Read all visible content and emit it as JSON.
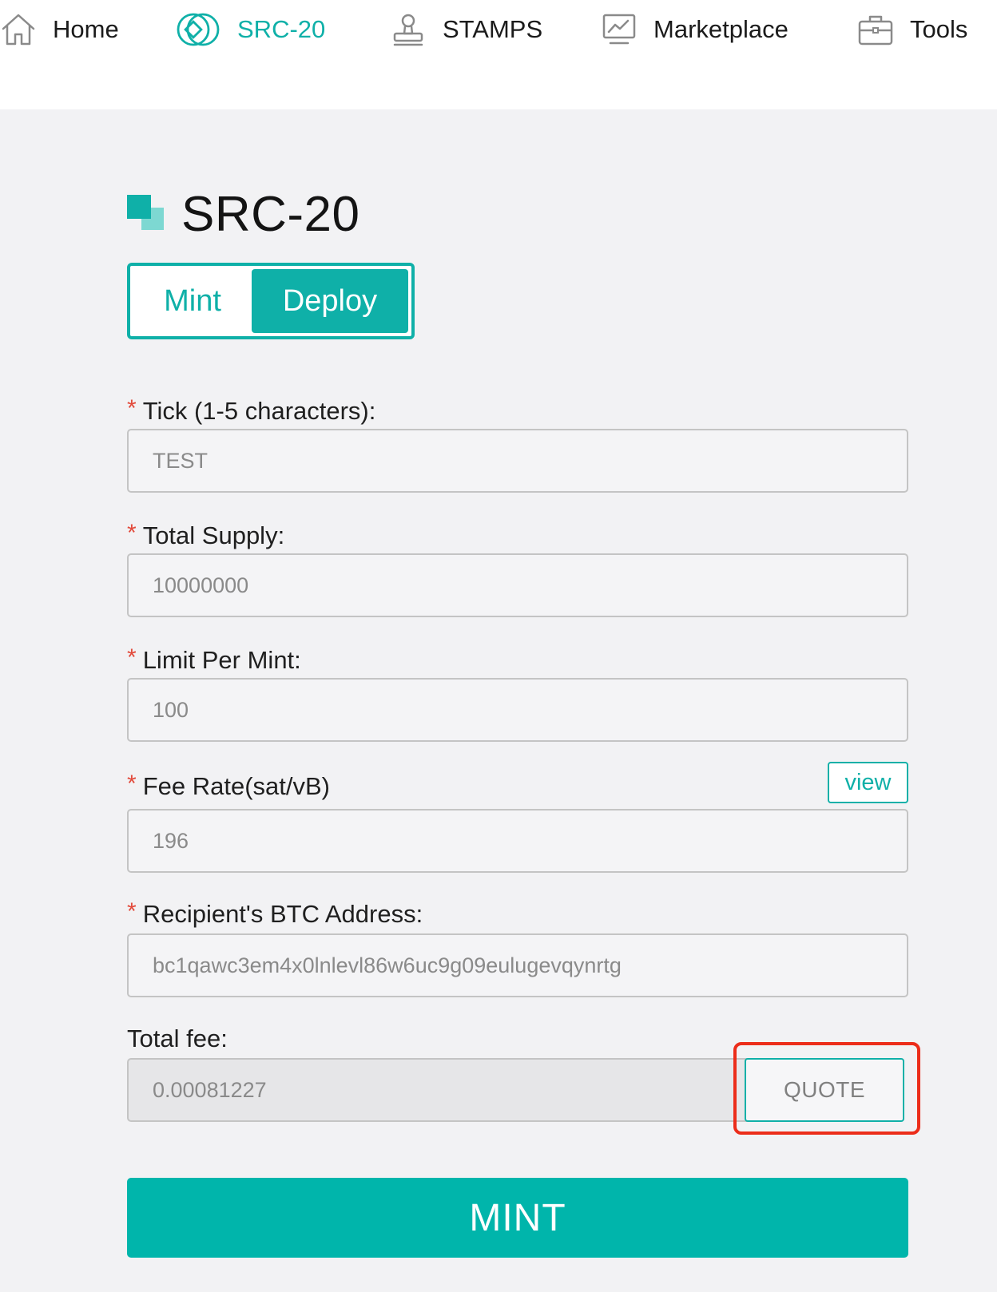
{
  "nav": {
    "items": [
      {
        "label": "Home",
        "icon": "home-icon"
      },
      {
        "label": "SRC-20",
        "icon": "src20-coin-icon",
        "active": true
      },
      {
        "label": "STAMPS",
        "icon": "stamp-icon"
      },
      {
        "label": "Marketplace",
        "icon": "chart-monitor-icon"
      },
      {
        "label": "Tools",
        "icon": "briefcase-icon"
      }
    ]
  },
  "page": {
    "title": "SRC-20",
    "title_icon": "stacked-squares-icon"
  },
  "tabs": {
    "mint_label": "Mint",
    "deploy_label": "Deploy",
    "active": "Deploy"
  },
  "form": {
    "required_mark": "*",
    "tick": {
      "label": "Tick (1-5 characters):",
      "value": "TEST"
    },
    "total_supply": {
      "label": "Total Supply:",
      "value": "10000000"
    },
    "limit_per_mint": {
      "label": "Limit Per Mint:",
      "value": "100"
    },
    "fee_rate": {
      "label": "Fee Rate(sat/vB)",
      "value": "196",
      "view_label": "view"
    },
    "recipient": {
      "label": "Recipient's BTC Address:",
      "value": "bc1qawc3em4x0lnlevl86w6uc9g09eulugevqynrtg"
    },
    "total_fee": {
      "label": "Total fee:",
      "value": "0.00081227",
      "quote_label": "QUOTE"
    },
    "submit_label": "MINT"
  },
  "colors": {
    "accent": "#0fb0a8",
    "required": "#e24a3b",
    "highlight": "#ec2d1a",
    "background": "#f2f2f4"
  }
}
